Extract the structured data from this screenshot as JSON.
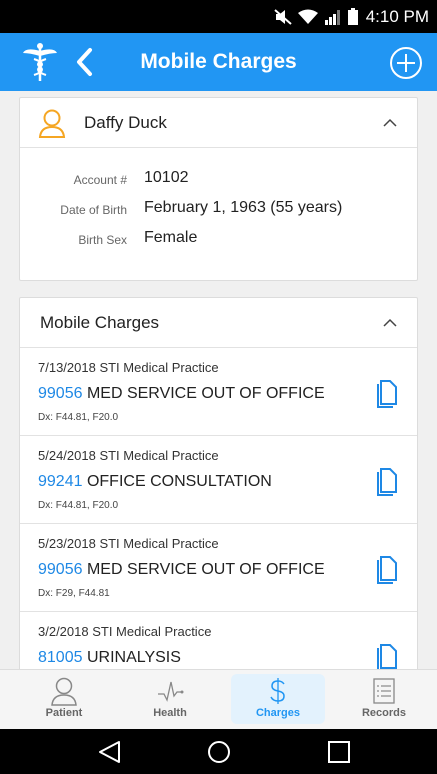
{
  "status_bar": {
    "time": "4:10 PM"
  },
  "app_bar": {
    "title": "Mobile Charges"
  },
  "patient": {
    "name": "Daffy Duck",
    "fields": [
      {
        "label": "Account #",
        "value": "10102"
      },
      {
        "label": "Date of Birth",
        "value": "February 1, 1963 (55 years)"
      },
      {
        "label": "Birth Sex",
        "value": "Female"
      }
    ]
  },
  "charges_section": {
    "title": "Mobile Charges",
    "items": [
      {
        "date_practice": "7/13/2018 STI Medical Practice",
        "code": "99056",
        "description": "MED SERVICE OUT OF OFFICE",
        "dx": "Dx: F44.81, F20.0"
      },
      {
        "date_practice": "5/24/2018 STI Medical Practice",
        "code": "99241",
        "description": "OFFICE CONSULTATION",
        "dx": "Dx: F44.81, F20.0"
      },
      {
        "date_practice": "5/23/2018 STI Medical Practice",
        "code": "99056",
        "description": "MED SERVICE OUT OF OFFICE",
        "dx": "Dx: F29, F44.81"
      },
      {
        "date_practice": "3/2/2018 STI Medical Practice",
        "code": "81005",
        "description": "URINALYSIS",
        "dx": ""
      }
    ]
  },
  "tabs": [
    {
      "label": "Patient",
      "icon": "person-icon",
      "active": false
    },
    {
      "label": "Health",
      "icon": "heartbeat-icon",
      "active": false
    },
    {
      "label": "Charges",
      "icon": "dollar-icon",
      "active": true
    },
    {
      "label": "Records",
      "icon": "list-icon",
      "active": false
    }
  ],
  "colors": {
    "primary": "#2196f3",
    "accent_orange": "#f5a623",
    "link": "#1e88e5"
  }
}
